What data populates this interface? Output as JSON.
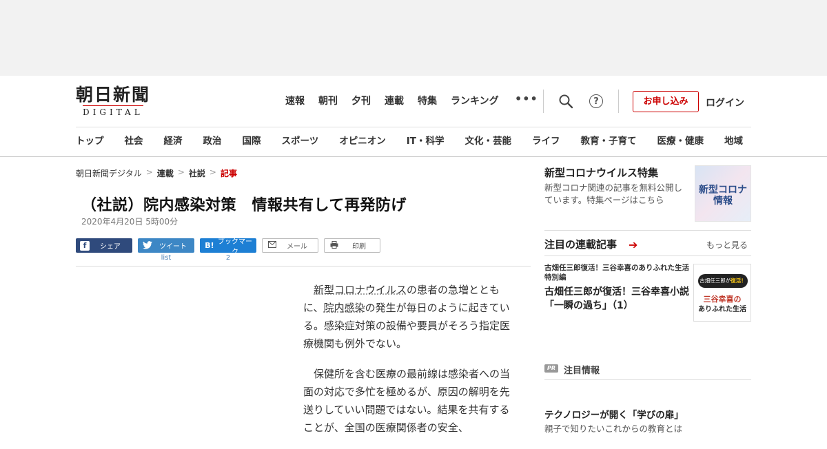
{
  "header": {
    "logo_main": "朝日新聞",
    "logo_sub": "DIGITAL",
    "top_nav": [
      "速報",
      "朝刊",
      "夕刊",
      "連載",
      "特集",
      "ランキング"
    ],
    "more_label": "•••",
    "help_label": "?",
    "subscribe_label": "お申し込み",
    "login_label": "ログイン",
    "categories": [
      "トップ",
      "社会",
      "経済",
      "政治",
      "国際",
      "スポーツ",
      "オピニオン",
      "IT・科学",
      "文化・芸能",
      "ライフ",
      "教育・子育て",
      "医療・健康",
      "地域"
    ]
  },
  "breadcrumb": {
    "items": [
      "朝日新聞デジタル",
      "連載",
      "社説",
      "記事"
    ],
    "sep": ">"
  },
  "article": {
    "title": "（社説）院内感染対策　情報共有して再発防げ",
    "date": "2020年4月20日 5時00分",
    "share": {
      "facebook": "シェア",
      "twitter": "ツイート",
      "twitter_count": "list",
      "hatena": "ブックマーク",
      "hatena_count": "2",
      "mail": "メール",
      "print": "印刷"
    },
    "p1_link1": "新型コロナウイルス",
    "p1_a": "の患者の急増とともに、",
    "p1_link2": "院内感染",
    "p1_b": "の発生が毎日のように起きている。感染症対策の設備や要員がそろう指定医療機関も例外でない。",
    "p2": "保健所を含む医療の最前線は感染者への当面の対応で多忙を極めるが、原因の解明を先送りしていい問題ではない。結果を共有することが、全国の医療関係者の安全、"
  },
  "sidebar": {
    "promo_title": "新型コロナウイルス特集",
    "promo_text": "新型コロナ関連の記事を無料公開しています。特集ページはこちら",
    "promo_thumb_1": "新型コロナ",
    "promo_thumb_2": "情報",
    "series_heading": "注目の連載記事",
    "series_more": "もっと見る",
    "series_small": "古畑任三郎復活！三谷幸喜のありふれた生活特別編",
    "series_title": "古畑任三郎が復活！三谷幸喜小説「一瞬の過ち」（1）",
    "series_thumb_badge_a": "古畑任三郎が",
    "series_thumb_badge_b": "復活！",
    "series_thumb_l2": "三谷幸喜の",
    "series_thumb_l3": "ありふれた生活",
    "pr_badge": "PR",
    "pr_label": "注目情報",
    "tech_title": "テクノロジーが開く「学びの扉」",
    "tech_sub": "親子で知りたいこれからの教育とは"
  }
}
